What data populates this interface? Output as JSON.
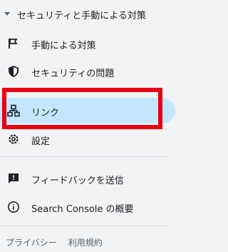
{
  "section": {
    "title": "セキュリティと手動による対策"
  },
  "items": [
    {
      "label": "手動による対策",
      "icon": "flag-icon"
    },
    {
      "label": "セキュリティの問題",
      "icon": "shield-icon"
    },
    {
      "label": "リンク",
      "icon": "sitemap-icon"
    },
    {
      "label": "設定",
      "icon": "gear-icon"
    },
    {
      "label": "フィードバックを送信",
      "icon": "feedback-icon"
    },
    {
      "label": "Search Console の概要",
      "icon": "info-icon"
    }
  ],
  "footer": {
    "privacy": "プライバシー",
    "terms": "利用規約"
  },
  "colors": {
    "active_bg": "#c2e7ff",
    "highlight": "#e60012",
    "sidebar_bg": "#f1f3f4"
  }
}
